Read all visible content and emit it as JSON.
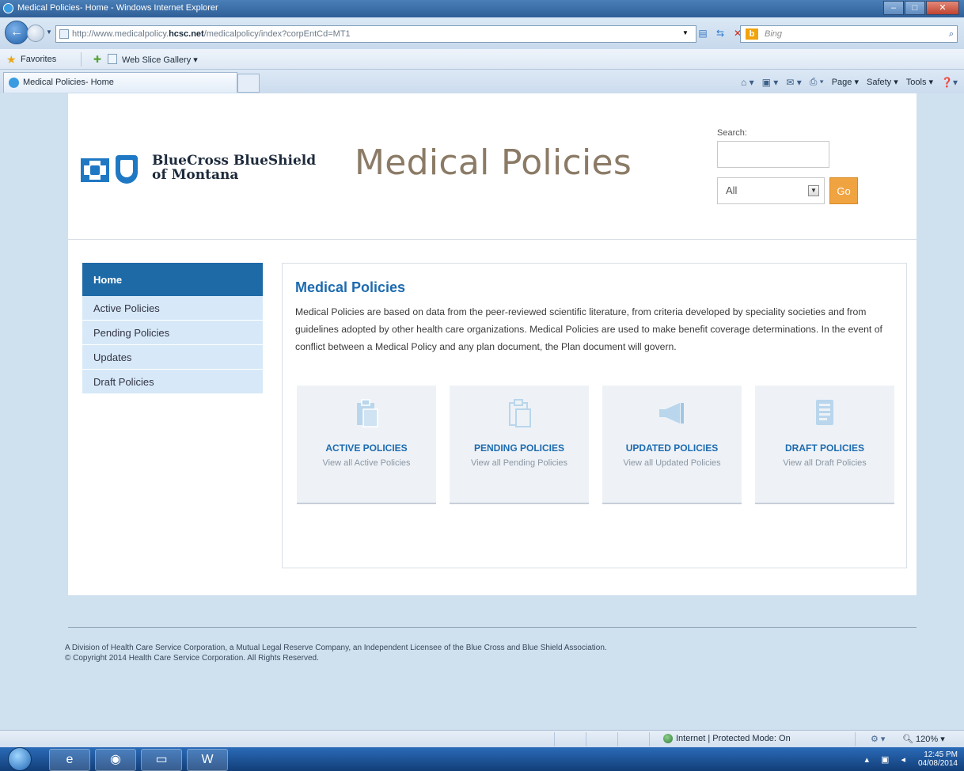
{
  "browser": {
    "window_title": "Medical Policies- Home - Windows Internet Explorer",
    "address_prefix": "http://www.medicalpolicy.",
    "address_domain": "hcsc.net",
    "address_suffix": "/medicalpolicy/index?corpEntCd=MT1",
    "search_provider": "Bing",
    "favorites_label": "Favorites",
    "web_slice_label": "Web Slice Gallery ▾",
    "tab_title": "Medical Policies- Home",
    "cmd": {
      "page": "Page ▾",
      "safety": "Safety ▾",
      "tools": "Tools ▾"
    },
    "status_zone": "Internet | Protected Mode: On",
    "zoom": "\u0001 120%"
  },
  "taskbar": {
    "time": "12:45 PM",
    "date": "04/08/2014"
  },
  "header": {
    "logo_line1": "BlueCross BlueShield",
    "logo_line2": "of Montana",
    "site_title": "Medical Policies",
    "search_label": "Search:",
    "search_value": "",
    "scope_selected": "All",
    "go_label": "Go"
  },
  "sidebar": {
    "items": [
      {
        "label": "Home"
      },
      {
        "label": "Active Policies"
      },
      {
        "label": "Pending Policies"
      },
      {
        "label": "Updates"
      },
      {
        "label": "Draft Policies"
      }
    ]
  },
  "main": {
    "heading": "Medical Policies",
    "intro": "Medical Policies are based on data from the peer-reviewed scientific literature, from criteria developed by speciality societies and from guidelines adopted by other health care organizations. Medical Policies are used to make benefit coverage determinations. In the event of conflict between a Medical Policy and any plan document, the Plan document will govern.",
    "tiles": [
      {
        "title": "ACTIVE POLICIES",
        "subtitle": "View all Active Policies",
        "icon": "clipboard-icon"
      },
      {
        "title": "PENDING POLICIES",
        "subtitle": "View all Pending Policies",
        "icon": "clipboard-outline-icon"
      },
      {
        "title": "UPDATED POLICIES",
        "subtitle": "View all Updated Policies",
        "icon": "megaphone-icon"
      },
      {
        "title": "DRAFT POLICIES",
        "subtitle": "View all Draft Policies",
        "icon": "document-icon"
      }
    ]
  },
  "footer": {
    "line1": "A Division of Health Care Service Corporation, a Mutual Legal Reserve Company, an Independent Licensee of the Blue Cross and Blue Shield Association.",
    "line2": "© Copyright 2014 Health Care Service Corporation. All Rights Reserved."
  },
  "colors": {
    "brand_blue": "#1e6aa7",
    "heading_blue": "#1d6bb0",
    "go_orange": "#f0a341",
    "title_brown": "#8b7b66"
  }
}
